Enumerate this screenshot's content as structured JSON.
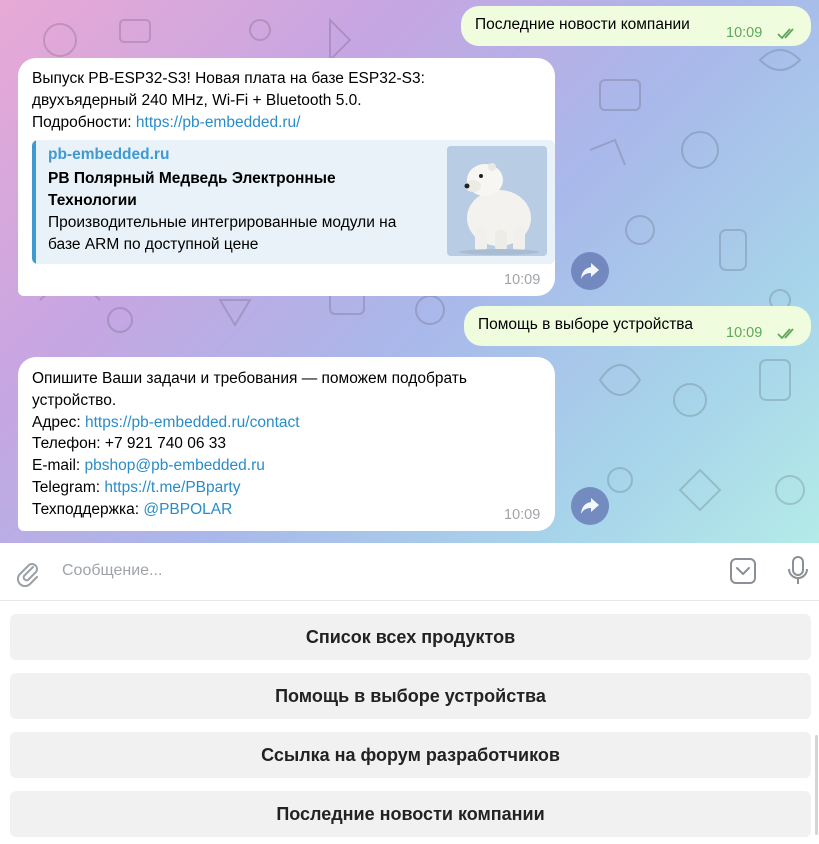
{
  "messages": {
    "out1": {
      "text": "Последние новости компании",
      "time": "10:09"
    },
    "in1": {
      "line1": "Выпуск PB-ESP32-S3! Новая плата на базе ESP32-S3:",
      "line2": "двухъядерный 240 MHz, Wi-Fi + Bluetooth 5.0.",
      "line3_prefix": "Подробности: ",
      "line3_link": "https://pb-embedded.ru/",
      "preview": {
        "site": "pb-embedded.ru",
        "title": "PB Полярный Медведь Электронные Технологии",
        "description": "Производительные интегрированные модули на базе ARM по доступной цене",
        "image": "polar-bear-icon"
      },
      "time": "10:09"
    },
    "out2": {
      "text": "Помощь в выборе устройства",
      "time": "10:09"
    },
    "in2": {
      "line1": "Опишите Ваши задачи и требования — поможем подобрать устройство.",
      "address_label": "Адрес: ",
      "address_link": "https://pb-embedded.ru/contact",
      "phone_label": "Телефон: ",
      "phone": "+7 921 740 06 33",
      "email_label": "E-mail: ",
      "email": "pbshop@pb-embedded.ru",
      "telegram_label": "Telegram: ",
      "telegram": "https://t.me/PBparty",
      "support_label": "Техподдержка: ",
      "support": "@PBPOLAR",
      "time": "10:09"
    }
  },
  "composer": {
    "placeholder": "Сообщение...",
    "attach_icon": "paperclip-icon",
    "keyboard_icon": "keyboard-toggle-icon",
    "mic_icon": "microphone-icon"
  },
  "keyboard_buttons": [
    "Список всех продуктов",
    "Помощь в выборе устройства",
    "Ссылка на форум разработчиков",
    "Последние новости компании"
  ],
  "colors": {
    "outgoing_bubble": "#effdde",
    "incoming_bubble": "#ffffff",
    "link": "#2a8cc7",
    "read_ticks": "#5ea85a"
  }
}
